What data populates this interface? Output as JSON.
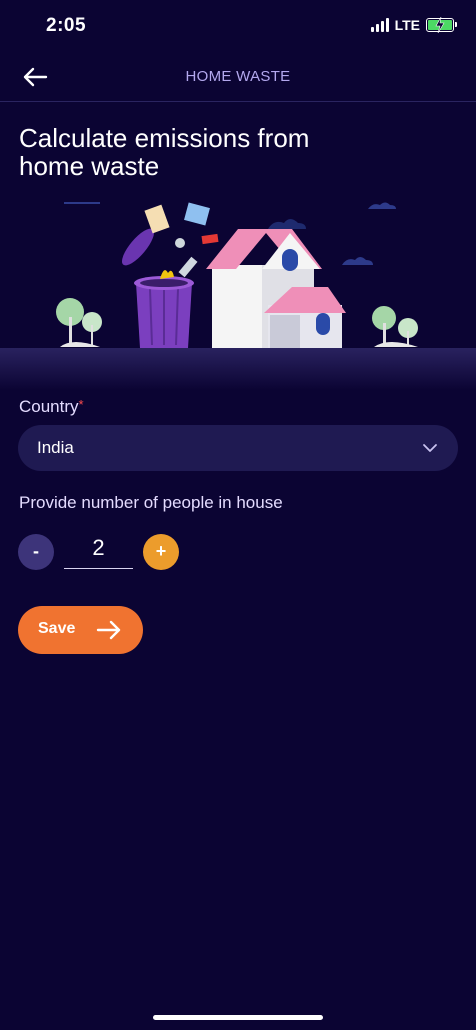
{
  "status_bar": {
    "time": "2:05",
    "network": "LTE"
  },
  "nav": {
    "title": "HOME WASTE"
  },
  "page": {
    "title_line1": "Calculate emissions from",
    "title_line2": "home waste"
  },
  "form": {
    "country_label": "Country",
    "required_marker": "*",
    "country_value": "India",
    "people_label": "Provide number of people in house",
    "minus_label": "-",
    "people_count": "2",
    "plus_label": "+",
    "save_label": "Save"
  },
  "colors": {
    "background": "#0b0433",
    "select_bg": "#1f1a52",
    "accent_orange": "#f07330",
    "plus_orange": "#ec9c2c",
    "minus_purple": "#3d347a",
    "nav_title": "#b3a8ee"
  }
}
